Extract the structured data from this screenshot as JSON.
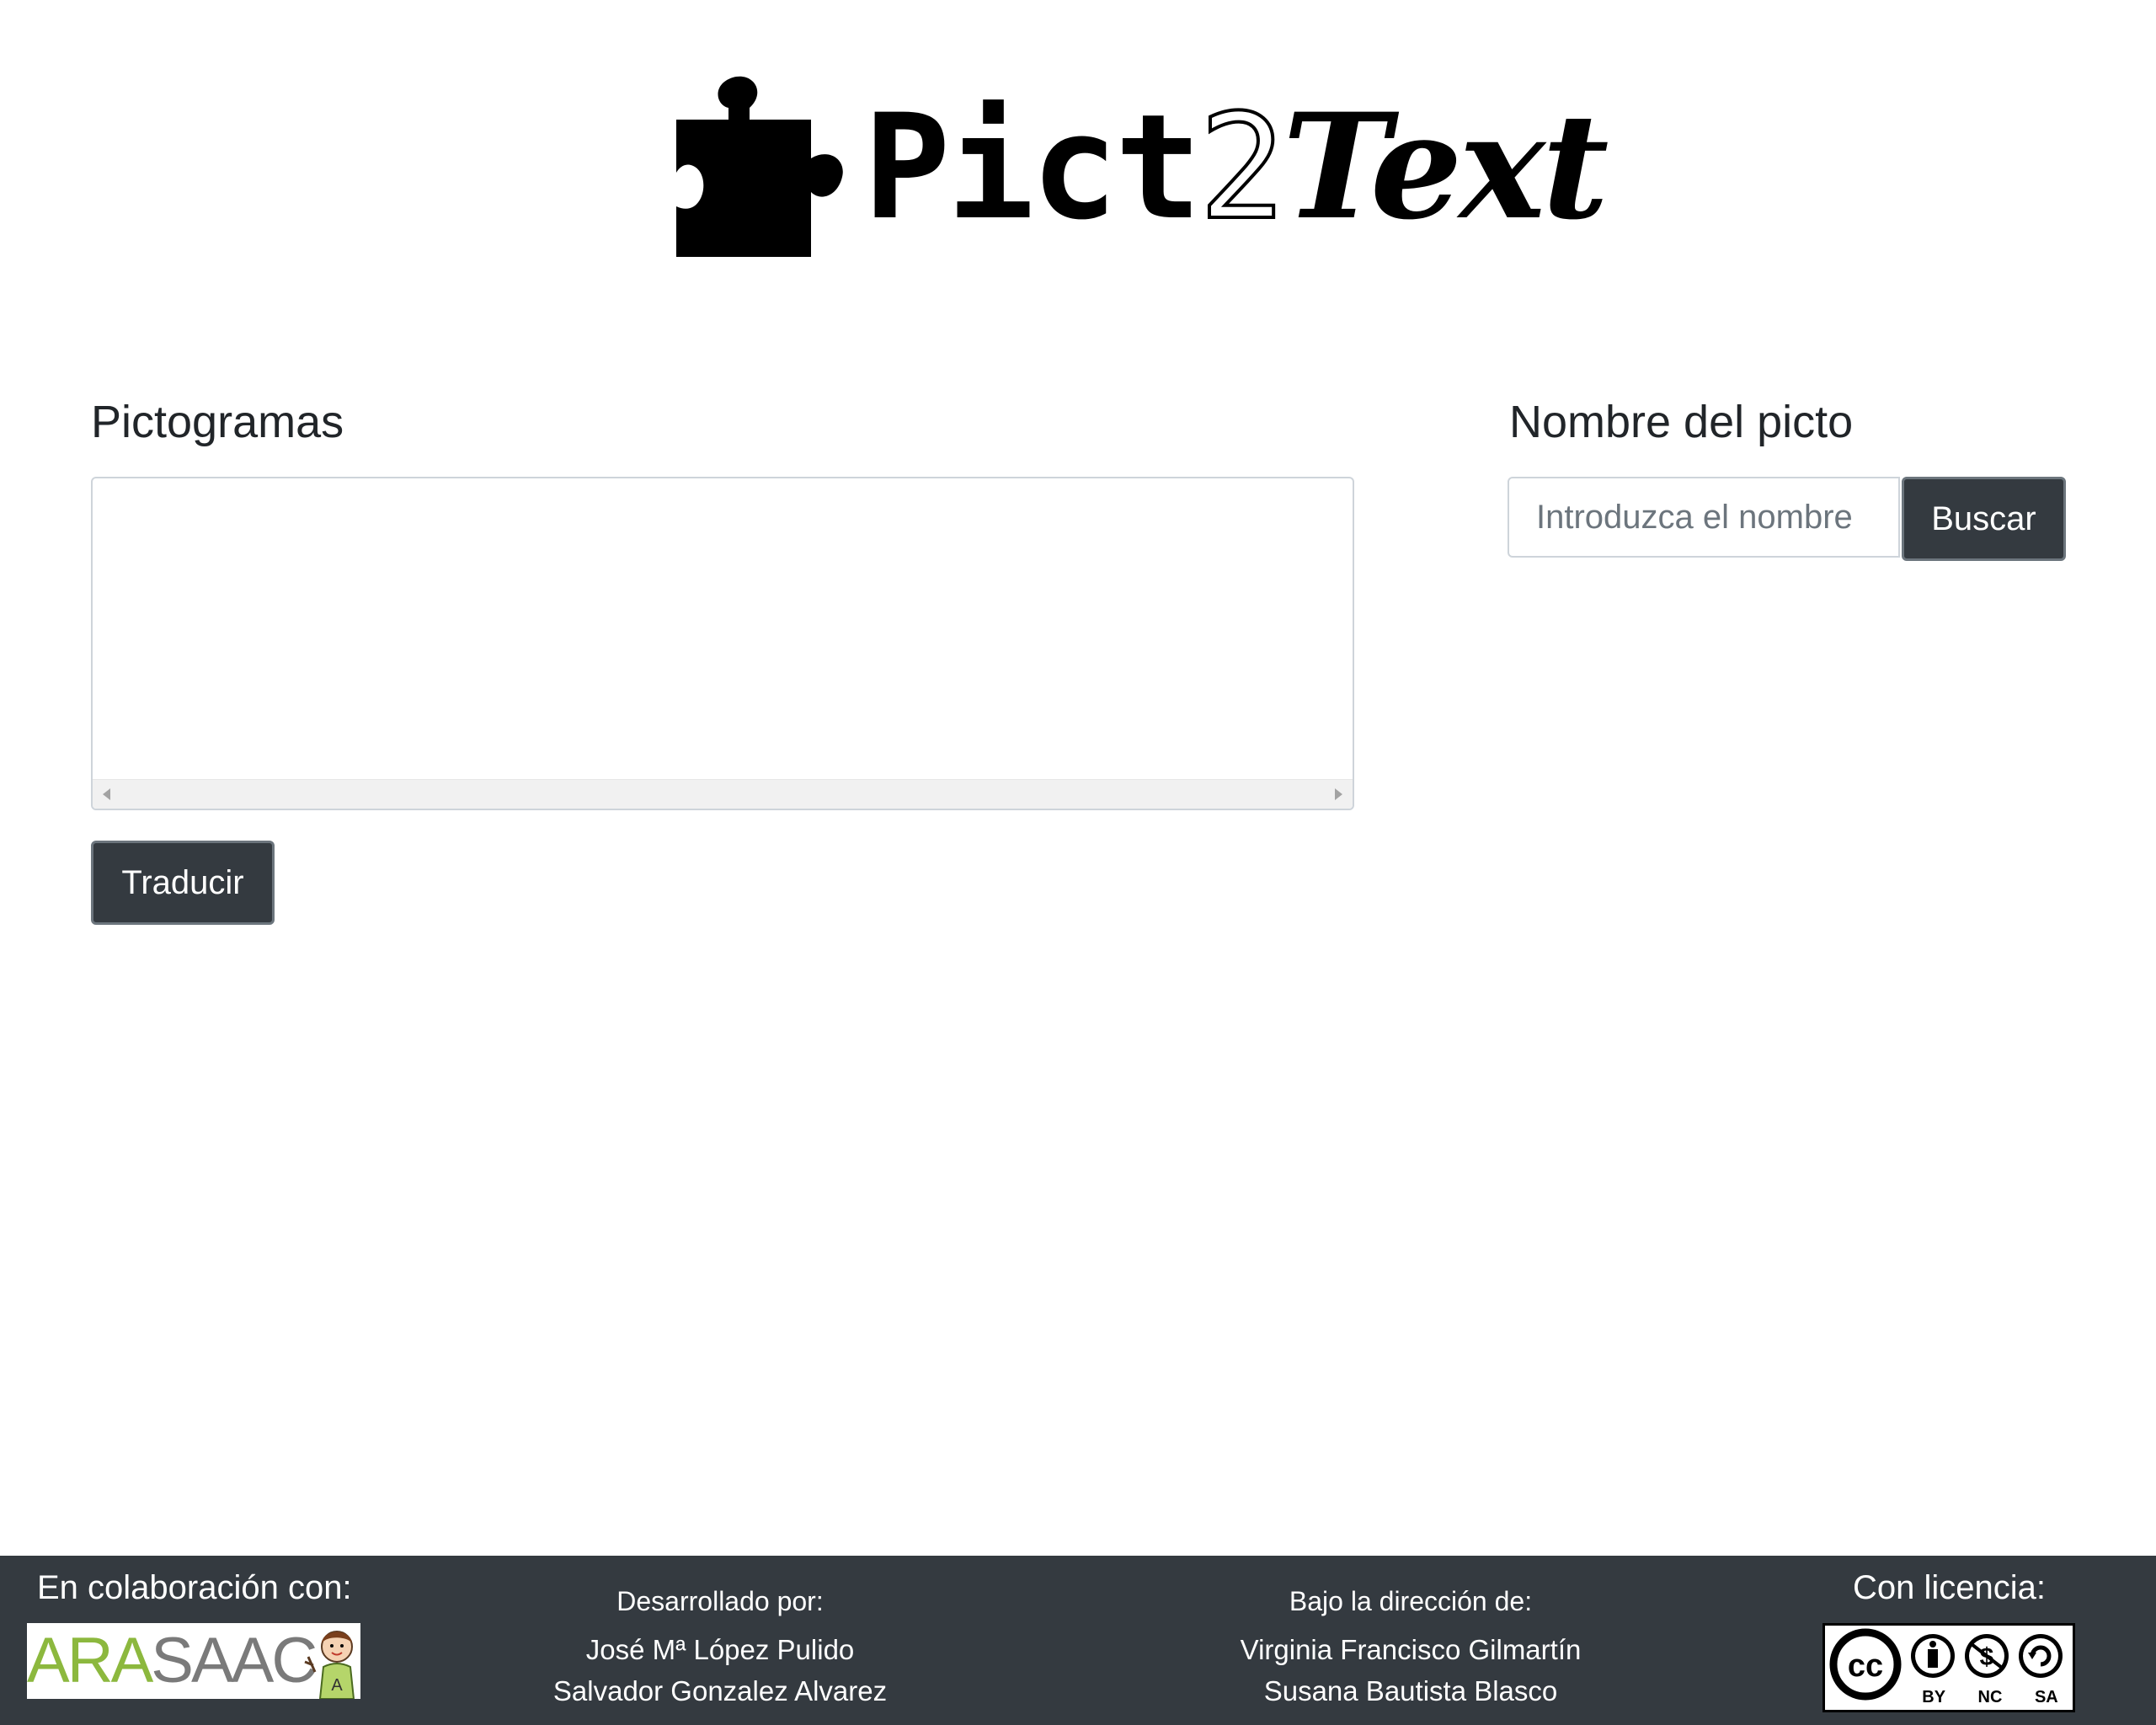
{
  "logo": {
    "part1": "Pict",
    "part2": "2",
    "part3": "Text"
  },
  "left_panel": {
    "title": "Pictogramas",
    "translate_button": "Traducir"
  },
  "right_panel": {
    "title": "Nombre del picto",
    "search_placeholder": "Introduzca el nombre",
    "search_value": "",
    "search_button": "Buscar"
  },
  "footer": {
    "collab_title": "En colaboración con:",
    "collab_logo": {
      "part1": "ARA",
      "part2": "SAAC"
    },
    "developed_title": "Desarrollado por:",
    "developers": [
      "José Mª López Pulido",
      "Salvador Gonzalez Alvarez"
    ],
    "direction_title": "Bajo la dirección de:",
    "directors": [
      "Virginia Francisco Gilmartín",
      "Susana Bautista Blasco"
    ],
    "license_title": "Con licencia:",
    "license_labels": [
      "BY",
      "NC",
      "SA"
    ]
  },
  "colors": {
    "dark": "#343a40",
    "border": "#ced4da",
    "arasaac_green": "#8cb83e"
  }
}
